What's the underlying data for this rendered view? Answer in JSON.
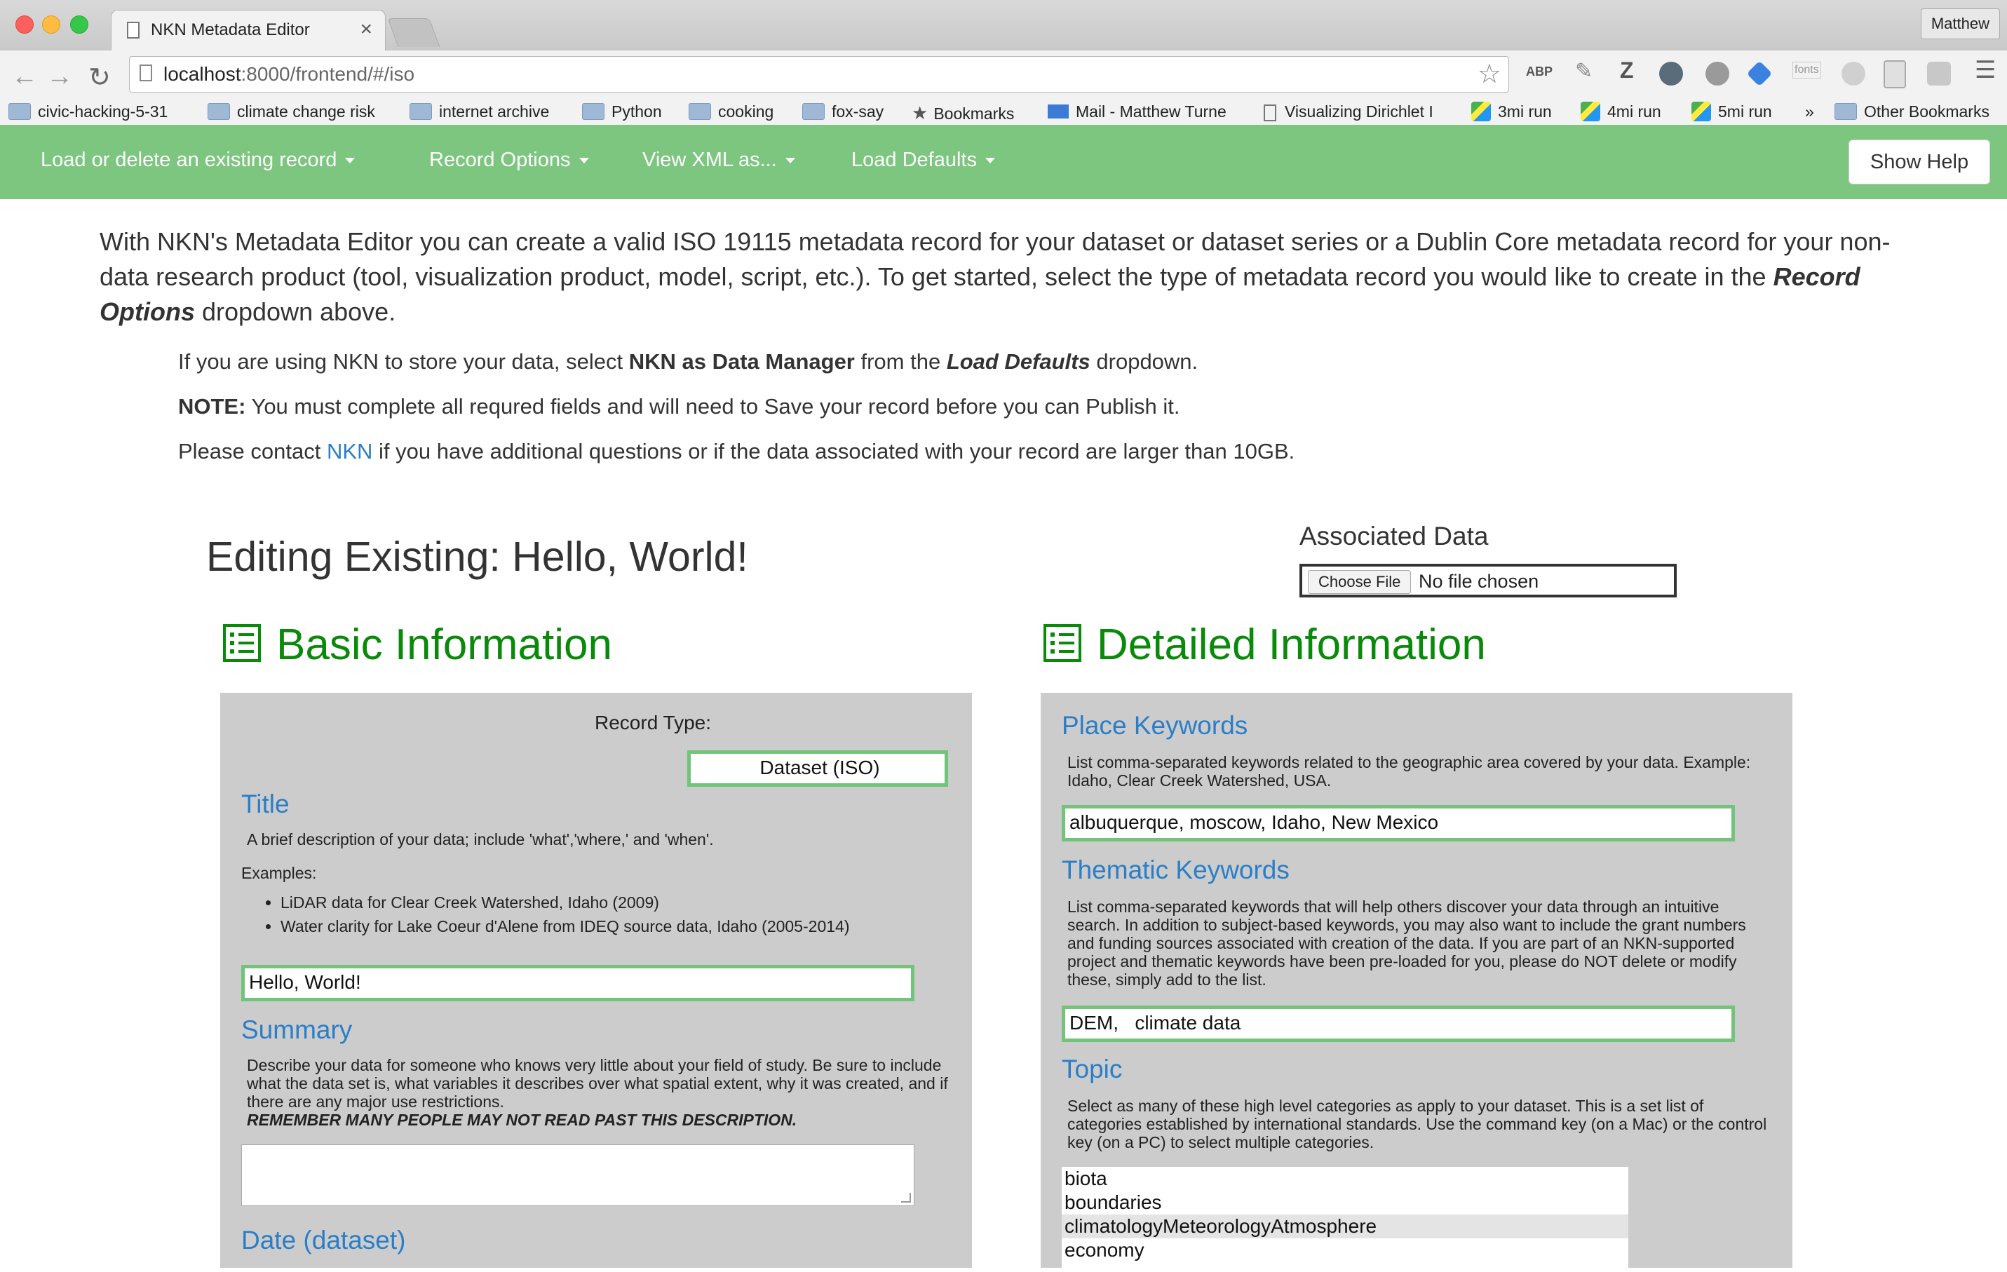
{
  "browser": {
    "tab_title": "NKN Metadata Editor",
    "tab_close": "×",
    "profile": "Matthew",
    "url_host": "localhost",
    "url_path": ":8000/frontend/#/iso",
    "extensions": [
      "ABP",
      "Z",
      "fonts"
    ],
    "bookmarks": [
      {
        "label": "civic-hacking-5-31",
        "icon": "folder-icon"
      },
      {
        "label": "climate change risk",
        "icon": "folder-icon"
      },
      {
        "label": "internet archive",
        "icon": "folder-icon"
      },
      {
        "label": "Python",
        "icon": "folder-icon"
      },
      {
        "label": "cooking",
        "icon": "folder-icon"
      },
      {
        "label": "fox-say",
        "icon": "folder-icon"
      },
      {
        "label": "Bookmarks",
        "icon": "star-icon"
      },
      {
        "label": "Mail - Matthew Turne",
        "icon": "mail-icon"
      },
      {
        "label": "Visualizing Dirichlet I",
        "icon": "page-icon"
      },
      {
        "label": "3mi run",
        "icon": "map-icon"
      },
      {
        "label": "4mi run",
        "icon": "map-icon"
      },
      {
        "label": "5mi run",
        "icon": "map-icon"
      },
      {
        "label": "»",
        "icon": "none"
      },
      {
        "label": "Other Bookmarks",
        "icon": "folder-icon"
      }
    ]
  },
  "navbar": {
    "menus": [
      "Load or delete an existing record",
      "Record Options",
      "View XML as...",
      "Load Defaults"
    ],
    "help_button": "Show Help",
    "accent_color": "#7dc67f"
  },
  "intro": {
    "text_1": "With NKN's Metadata Editor you can create a valid ISO 19115 metadata record for your dataset or dataset series or a Dublin Core metadata record for your non-data research product (tool, visualization product, model, script, etc.). To get started, select the type of metadata record you would like to create in the ",
    "emph": "Record Options",
    "text_2": " dropdown above.",
    "p1_a": "If you are using NKN to store your data, select ",
    "p1_b": "NKN as Data Manager",
    "p1_c": " from the ",
    "p1_d": "Load Defaults",
    "p1_e": " dropdown.",
    "p2_a": "NOTE:",
    "p2_b": " You must complete all requred fields and will need to Save your record before you can Publish it.",
    "p3_a": "Please contact ",
    "p3_link": "NKN",
    "p3_b": " if you have additional questions or if the data associated with your record are larger than 10GB."
  },
  "editing_title": "Editing Existing: Hello, World!",
  "associated_data": {
    "label": "Associated Data",
    "choose_button": "Choose File",
    "status": "No file chosen"
  },
  "basic": {
    "heading": "Basic Information",
    "record_type_label": "Record Type:",
    "record_type_value": "Dataset (ISO)",
    "title_label": "Title",
    "title_help": "A brief description of your data; include 'what','where,' and 'when'.",
    "examples_label": "Examples:",
    "examples": [
      "LiDAR data for Clear Creek Watershed, Idaho (2009)",
      "Water clarity for Lake Coeur d'Alene from IDEQ source data, Idaho (2005-2014)"
    ],
    "title_value": "Hello, World!",
    "summary_label": "Summary",
    "summary_help": "Describe your data for someone who knows very little about your field of study. Be sure to include what the data set is, what variables it describes over what spatial extent, why it was created, and if there are any major use restrictions.",
    "summary_warning": "REMEMBER MANY PEOPLE MAY NOT READ PAST THIS DESCRIPTION.",
    "summary_value": "",
    "date_label": "Date (dataset)"
  },
  "detailed": {
    "heading": "Detailed Information",
    "place_label": "Place Keywords",
    "place_help": "List comma-separated keywords related to the geographic area covered by your data. Example: Idaho, Clear Creek Watershed, USA.",
    "place_value": "albuquerque, moscow, Idaho, New Mexico",
    "thematic_label": "Thematic Keywords",
    "thematic_help": "List comma-separated keywords that will help others discover your data through an intuitive search. In addition to subject-based keywords, you may also want to include the grant numbers and funding sources associated with creation of the data. If you are part of an NKN-supported project and thematic keywords have been pre-loaded for you, please do NOT delete or modify these, simply add to the list.",
    "thematic_value": "DEM,   climate data",
    "topic_label": "Topic",
    "topic_help": "Select as many of these high level categories as apply to your dataset. This is a set list of categories established by international standards. Use the command key (on a Mac) or the control key (on a PC) to select multiple categories.",
    "topic_options": [
      "biota",
      "boundaries",
      "climatologyMeteorologyAtmosphere",
      "economy"
    ],
    "topic_selected": "climatologyMeteorologyAtmosphere"
  }
}
